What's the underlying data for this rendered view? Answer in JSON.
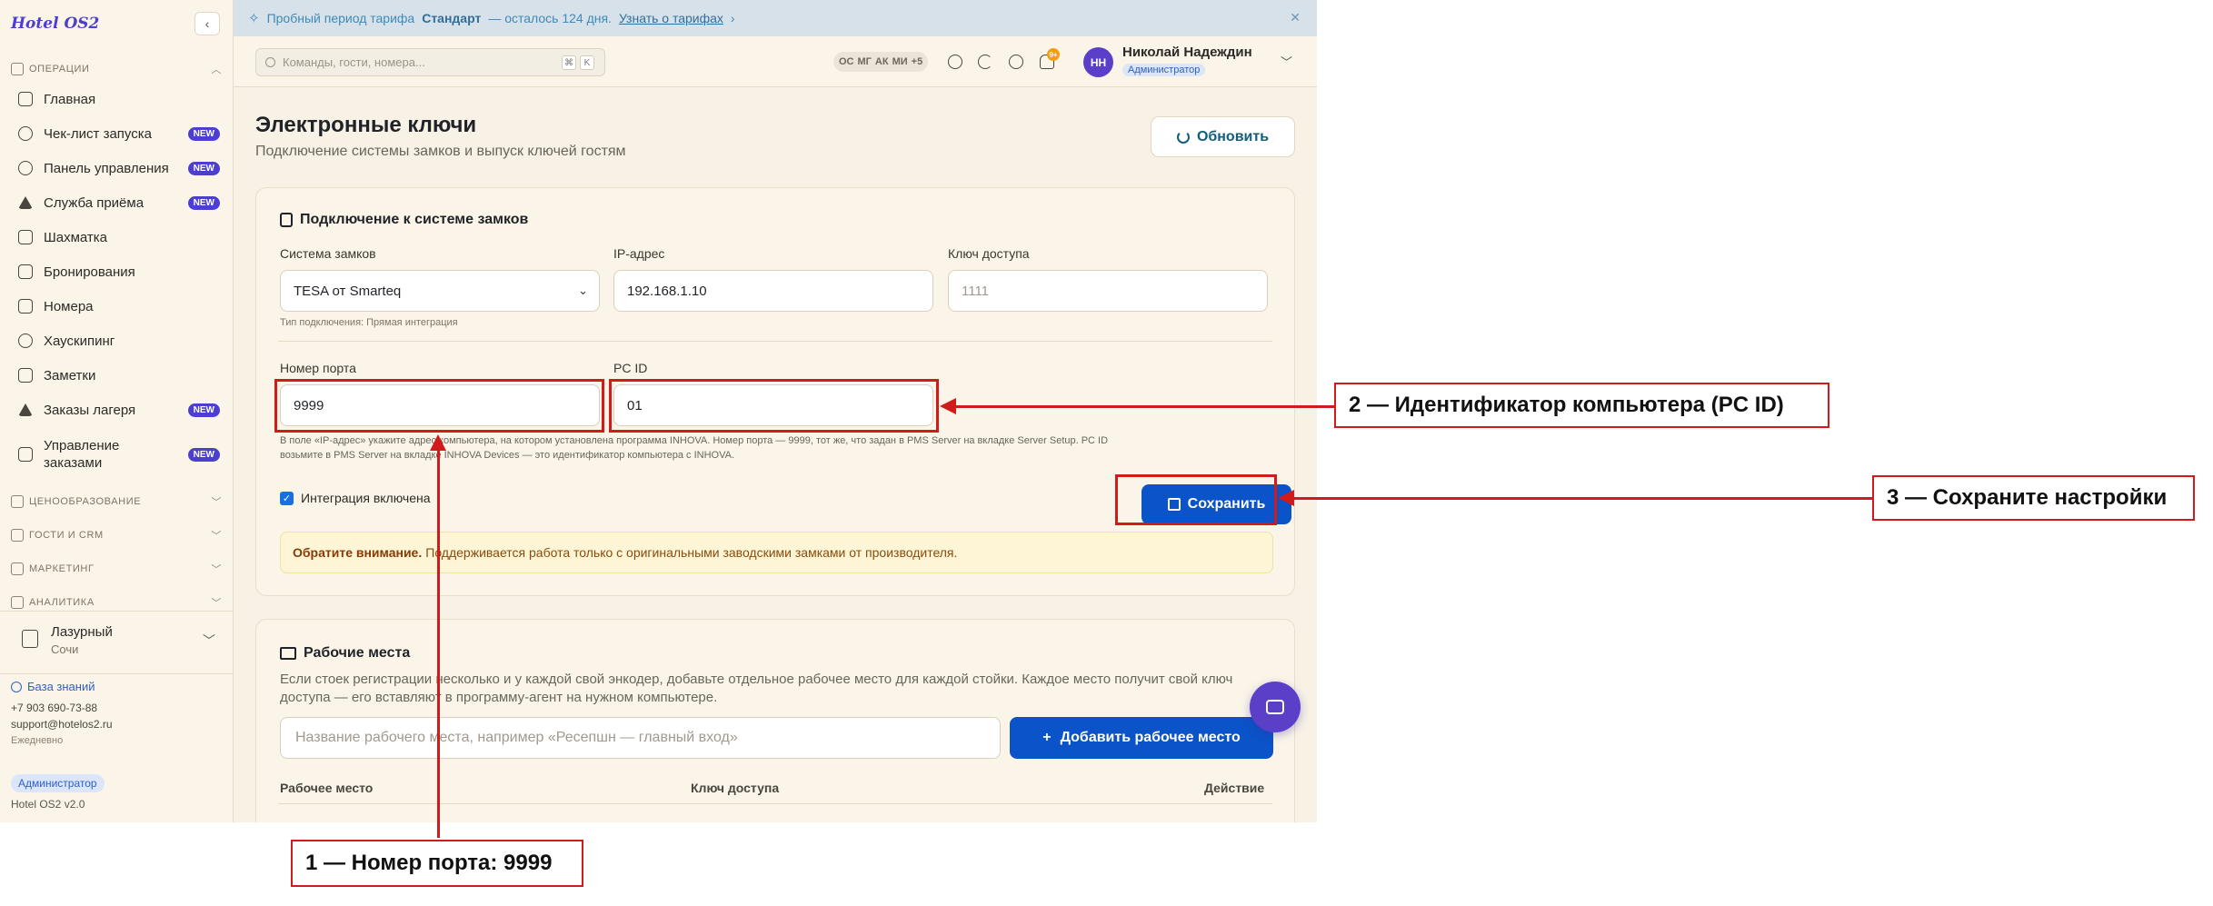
{
  "sidebar": {
    "brand": "Hotel OS2",
    "sections": {
      "operations": "ОПЕРАЦИИ",
      "pricing": "ЦЕНООБРАЗОВАНИЕ",
      "guests": "ГОСТИ И CRM",
      "marketing": "МАРКЕТИНГ",
      "analytics": "АНАЛИТИКА"
    },
    "items": [
      {
        "label": "Главная",
        "icon": "grid-icon"
      },
      {
        "label": "Чек-лист запуска",
        "icon": "rocket-icon",
        "badge": "NEW"
      },
      {
        "label": "Панель управления",
        "icon": "gauge-icon",
        "badge": "NEW"
      },
      {
        "label": "Служба приёма",
        "icon": "bell-service-icon",
        "badge": "NEW"
      },
      {
        "label": "Шахматка",
        "icon": "table-icon"
      },
      {
        "label": "Бронирования",
        "icon": "clipboard-icon"
      },
      {
        "label": "Номера",
        "icon": "door-icon"
      },
      {
        "label": "Хаускипинг",
        "icon": "sparkles-icon"
      },
      {
        "label": "Заметки",
        "icon": "note-icon"
      },
      {
        "label": "Заказы лагеря",
        "icon": "tent-icon",
        "badge": "NEW"
      },
      {
        "label": "Управление заказами",
        "icon": "orders-icon",
        "badge": "NEW"
      }
    ],
    "hotel": {
      "name": "Лазурный",
      "city": "Сочи"
    },
    "knowledge_base": "База знаний",
    "phone": "+7 903 690-73-88",
    "email": "support@hotelos2.ru",
    "schedule": "Ежедневно",
    "role": "Администратор",
    "version": "Hotel OS2 v2.0"
  },
  "trial": {
    "prefix": "Пробный период тарифа",
    "plan": "Стандарт",
    "suffix": "— осталось 124 дня.",
    "link": "Узнать о тарифах"
  },
  "topbar": {
    "search_placeholder": "Команды, гости, номера...",
    "kbd1": "⌘",
    "kbd2": "K",
    "initials": [
      "ОС",
      "МГ",
      "АК",
      "МИ",
      "+5"
    ],
    "notif_count": "9+",
    "user_initials": "НН",
    "user_name": "Николай Надеждин",
    "user_role": "Администратор"
  },
  "page": {
    "title": "Электронные ключи",
    "subtitle": "Подключение системы замков и выпуск ключей гостям",
    "refresh": "Обновить"
  },
  "lock_card": {
    "title": "Подключение к системе замков",
    "lock_system_label": "Система замков",
    "lock_system_value": "TESA от Smarteq",
    "connection_type": "Тип подключения: Прямая интеграция",
    "ip_label": "IP-адрес",
    "ip_value": "192.168.1.10",
    "access_key_label": "Ключ доступа",
    "access_key_placeholder": "1111",
    "port_label": "Номер порта",
    "port_value": "9999",
    "pcid_label": "PC ID",
    "pcid_value": "01",
    "note_line1": "В поле «IP-адрес» укажите адрес компьютера, на котором установлена программа INHOVA. Номер порта — 9999, тот же, что задан в PMS Server на вкладке Server Setup. PC ID",
    "note_line2": "возьмите в PMS Server на вкладке INHOVA Devices — это идентификатор компьютера с INHOVA.",
    "integration_label": "Интеграция включена",
    "save": "Сохранить",
    "warning_bold": "Обратите внимание.",
    "warning_text": "Поддерживается работа только с оригинальными заводскими замками от производителя."
  },
  "ws_card": {
    "title": "Рабочие места",
    "desc": "Если стоек регистрации несколько и у каждой свой энкодер, добавьте отдельное рабочее место для каждой стойки. Каждое место получит свой ключ доступа — его вставляют в программу-агент на нужном компьютере.",
    "input_placeholder": "Название рабочего места, например «Ресепшн — главный вход»",
    "add": "Добавить рабочее место",
    "col_place": "Рабочее место",
    "col_key": "Ключ доступа",
    "col_action": "Действие"
  },
  "annotations": {
    "a1": "1 — Номер порта: 9999",
    "a2": "2 — Идентификатор компьютера (PC ID)",
    "a3": "3 — Сохраните настройки"
  },
  "colors": {
    "accent": "#0b53c8",
    "brand": "#4c3fd0",
    "annotation": "#d11a1a"
  }
}
